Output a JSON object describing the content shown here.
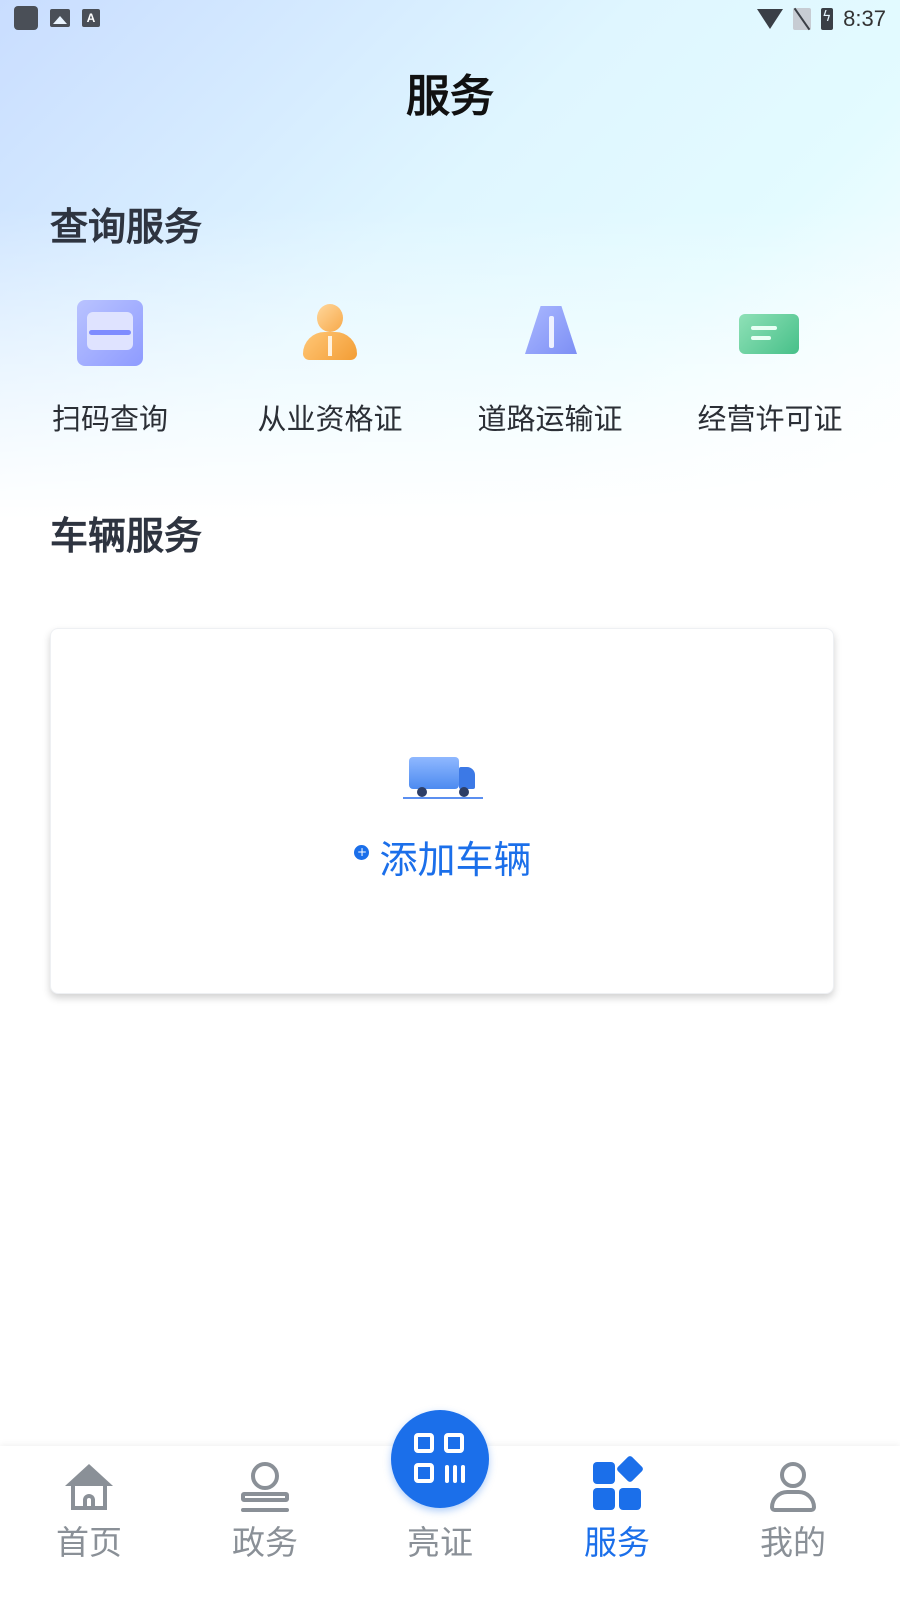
{
  "status_bar": {
    "time": "8:37",
    "notification_a": "A"
  },
  "header": {
    "title": "服务"
  },
  "query_section": {
    "title": "查询服务",
    "items": [
      {
        "label": "扫码查询",
        "icon": "scan-icon"
      },
      {
        "label": "从业资格证",
        "icon": "person-certificate-icon"
      },
      {
        "label": "道路运输证",
        "icon": "road-icon"
      },
      {
        "label": "经营许可证",
        "icon": "license-card-icon"
      }
    ]
  },
  "vehicle_section": {
    "title": "车辆服务",
    "add_label": "添加车辆",
    "add_icon": "plus-icon"
  },
  "bottom_nav": {
    "items": [
      {
        "label": "首页",
        "icon": "home-icon",
        "active": false
      },
      {
        "label": "政务",
        "icon": "stamp-icon",
        "active": false
      },
      {
        "label": "亮证",
        "icon": "qr-code-icon",
        "active": false
      },
      {
        "label": "服务",
        "icon": "grid-icon",
        "active": true
      },
      {
        "label": "我的",
        "icon": "user-icon",
        "active": false
      }
    ]
  },
  "colors": {
    "accent": "#1b6fea",
    "inactive": "#8a9097",
    "title": "#2e3440"
  }
}
